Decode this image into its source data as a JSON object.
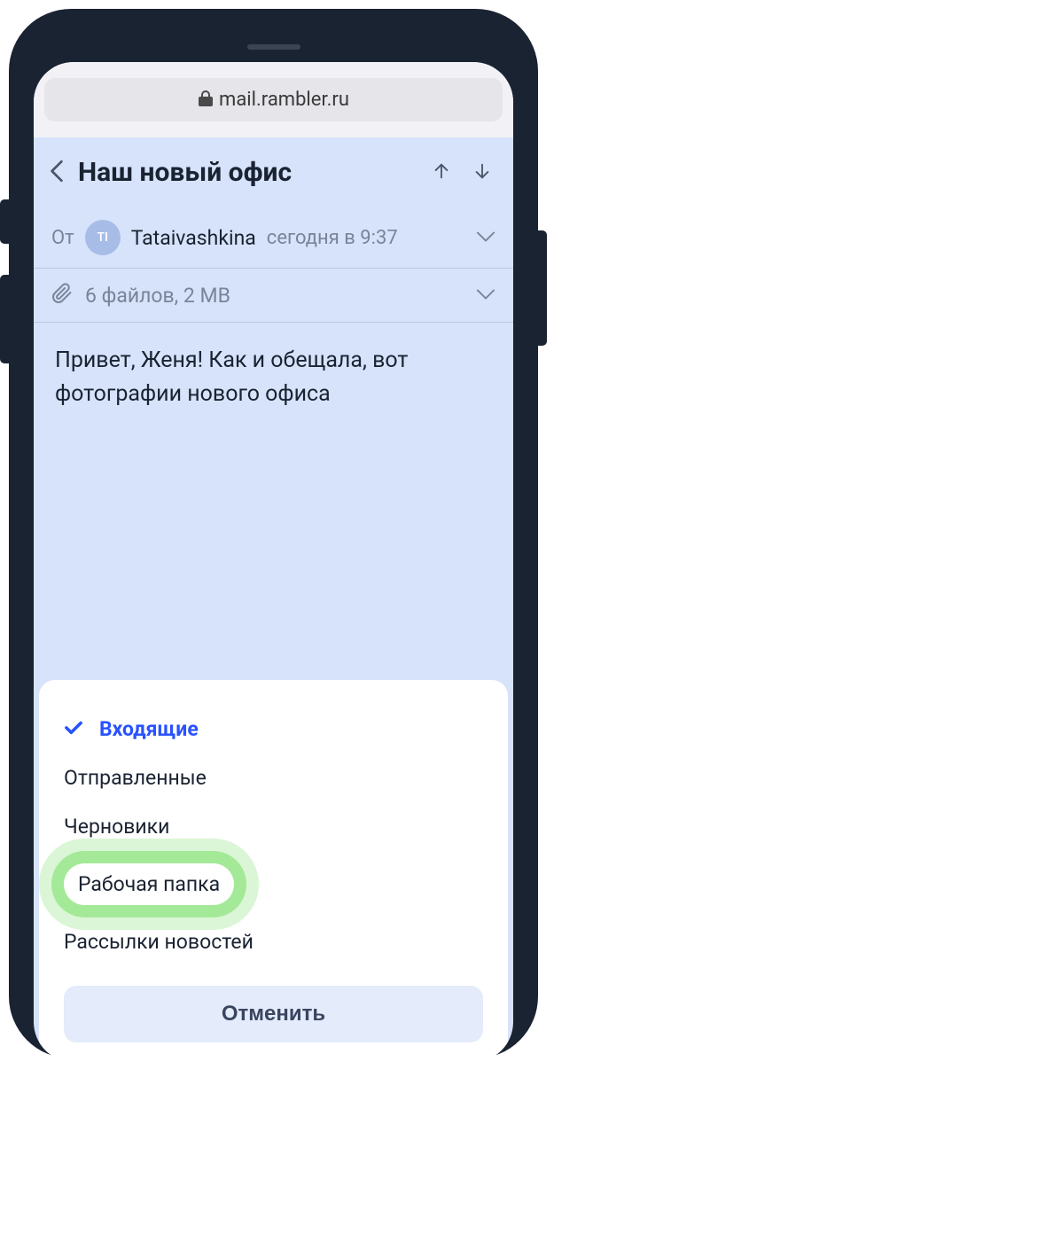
{
  "browser": {
    "url": "mail.rambler.ru"
  },
  "header": {
    "title": "Наш новый офис"
  },
  "from": {
    "label": "От",
    "avatar_initials": "TI",
    "sender": "Tataivashkina",
    "timestamp": "сегодня в 9:37"
  },
  "attachments": {
    "info": "6 файлов, 2 MB"
  },
  "body": "Привет, Женя! Как и обещала, вот фотографии нового офиса",
  "folder_sheet": {
    "folders": [
      {
        "label": "Входящие",
        "selected": true
      },
      {
        "label": "Отправленные",
        "selected": false
      },
      {
        "label": "Черновики",
        "selected": false
      },
      {
        "label": "Рабочая папка",
        "selected": false,
        "highlighted": true
      },
      {
        "label": "Рассылки новостей",
        "selected": false
      }
    ],
    "cancel_label": "Отменить"
  },
  "colors": {
    "accent": "#2952ff",
    "bg_light_blue": "#d7e3fa",
    "highlight_green": "#6edc5a"
  }
}
